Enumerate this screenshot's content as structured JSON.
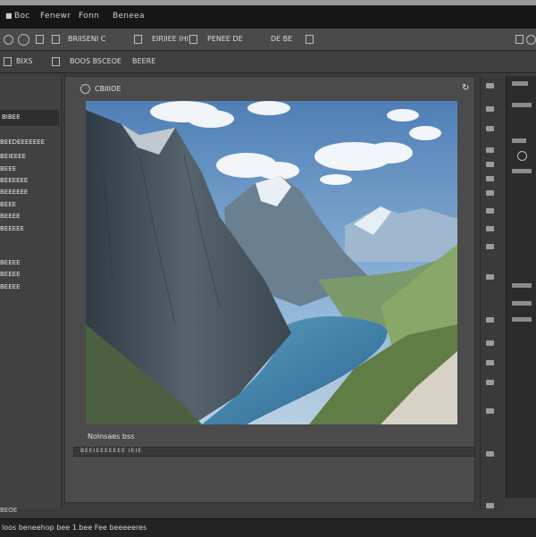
{
  "menubar": {
    "items": [
      "Boc",
      "Fenewr",
      "Fonn",
      "Beneea"
    ]
  },
  "options_bar": {
    "group1": "BRIISENI C",
    "group2": "EIRIIEE IHI",
    "group3": "PENEE DE",
    "group4": "DE BE"
  },
  "options_bar2": {
    "left": "BIXS",
    "main": "BOOS BSCEOE",
    "extra": "BEERE"
  },
  "left_panel": {
    "header": "BIBEE",
    "items": [
      "BEEDEEEEEEE",
      "BEIEEEE",
      "BEEE",
      "BEEEEEE",
      "BEEEEEE",
      "BEEE",
      "BEEEE",
      "BEEEEE",
      "BEEEE",
      "BEEEE",
      "BEEEE"
    ]
  },
  "document": {
    "title": "CBIIIOE",
    "caption": "Nolnsaes bss",
    "scroll_text": "BEEIEEEEEEE IEIE"
  },
  "status": {
    "zoom": "BEOE",
    "text": "loos beneehop bee 1.bee Fee beeeeeres"
  },
  "colors": {
    "sky": "#5f8fc4",
    "water": "#3a7aa6",
    "grass": "#6f8f4a",
    "rock": "#3f4a55"
  }
}
